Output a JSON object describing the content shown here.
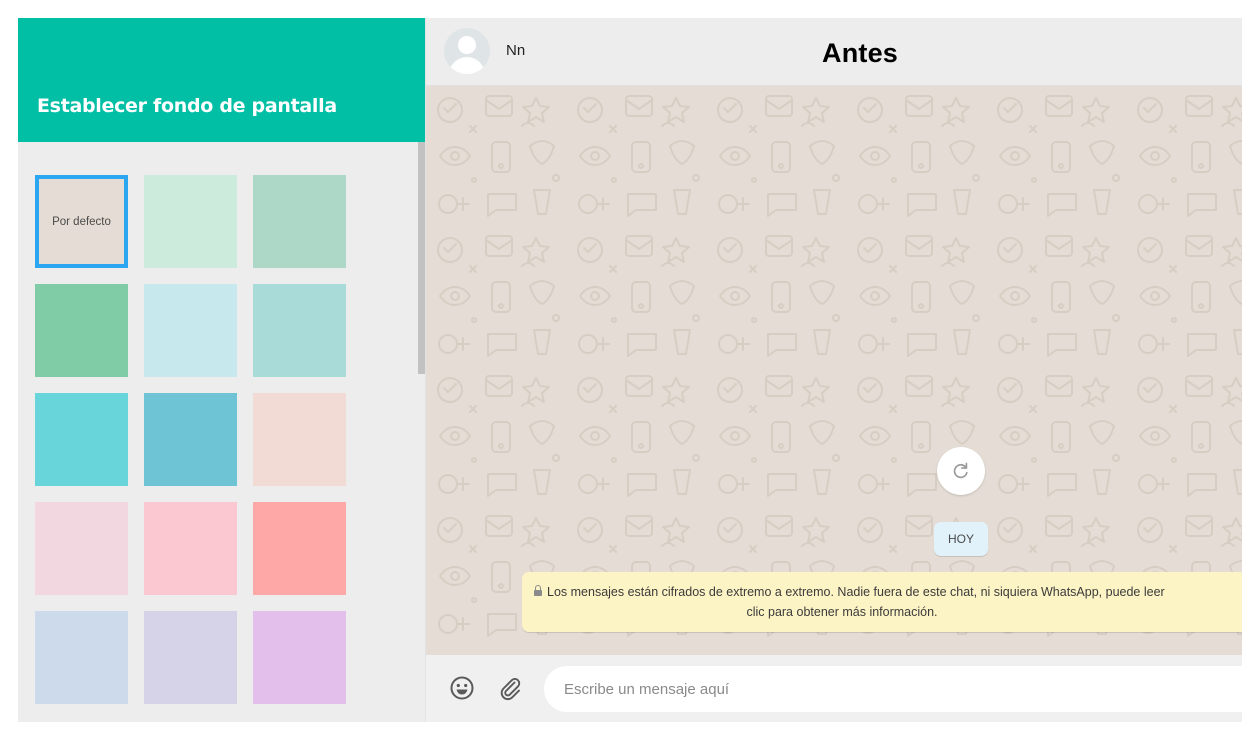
{
  "overlay_title": "Antes",
  "wallpaper_panel": {
    "title": "Establecer fondo de pantalla",
    "swatches": [
      {
        "label": "Por defecto",
        "color": "#e5ddd5",
        "selected": true
      },
      {
        "label": "",
        "color": "#cdebdd"
      },
      {
        "label": "",
        "color": "#add8c7"
      },
      {
        "label": "",
        "color": "#7fcca7"
      },
      {
        "label": "",
        "color": "#c7e8ec"
      },
      {
        "label": "",
        "color": "#a9dbd8"
      },
      {
        "label": "",
        "color": "#68d5da"
      },
      {
        "label": "",
        "color": "#6ec3d4"
      },
      {
        "label": "",
        "color": "#f2dad5"
      },
      {
        "label": "",
        "color": "#f2d6e0"
      },
      {
        "label": "",
        "color": "#fbc8d1"
      },
      {
        "label": "",
        "color": "#ffa8a8"
      },
      {
        "label": "",
        "color": "#ccdaeb"
      },
      {
        "label": "",
        "color": "#d6d3e8"
      },
      {
        "label": "",
        "color": "#e3c0eb"
      }
    ]
  },
  "chat": {
    "contact_name": "Nn",
    "date_chip": "HOY",
    "encryption_notice": {
      "line1": "Los mensajes están cifrados de extremo a extremo. Nadie fuera de este chat, ni siquiera WhatsApp, puede leer",
      "line2": "clic para obtener más información."
    },
    "composer": {
      "placeholder": "Escribe un mensaje aquí"
    }
  },
  "colors": {
    "accent": "#00bfa5",
    "selected_border": "#2ba7f2",
    "chat_background": "#e5ddd5",
    "notice_background": "#fdf4c5",
    "date_chip_background": "#e1f2fb"
  },
  "icons": {
    "refresh": "refresh-icon",
    "emoji": "smiley-icon",
    "attach": "paperclip-icon",
    "lock": "lock-icon",
    "avatar": "default-avatar-icon"
  }
}
